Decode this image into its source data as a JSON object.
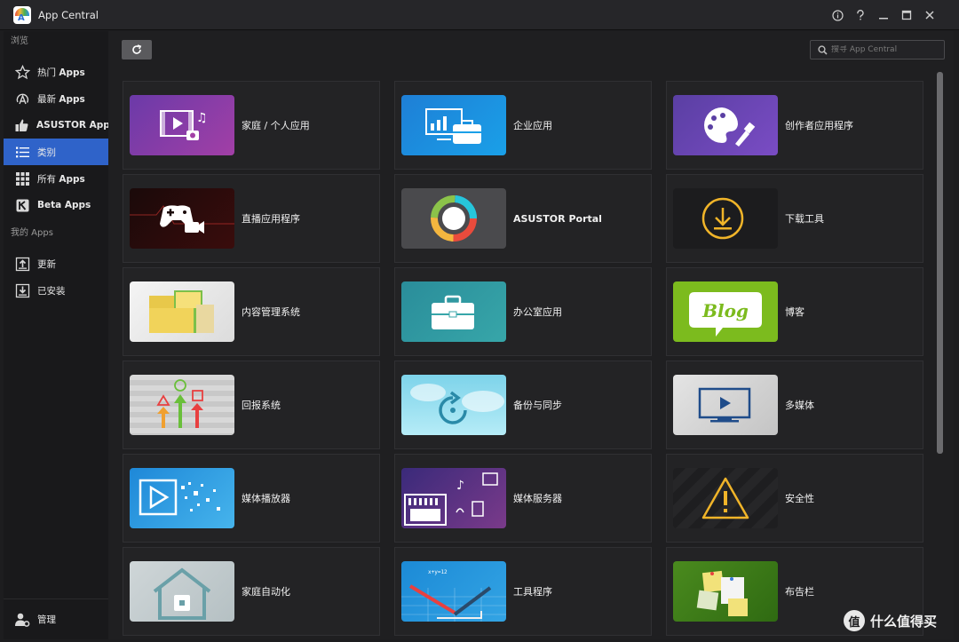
{
  "window": {
    "title": "App Central"
  },
  "sidebar": {
    "browse_label": "浏览",
    "browse_items": [
      {
        "label_cn": "热门 ",
        "label_en": "Apps",
        "icon": "star-icon"
      },
      {
        "label_cn": "最新 ",
        "label_en": "Apps",
        "icon": "new-icon"
      },
      {
        "label_cn": "",
        "label_en": "ASUSTOR Apps",
        "icon": "thumbs-up-icon"
      },
      {
        "label_cn": "类别",
        "label_en": "",
        "icon": "list-icon",
        "active": true
      },
      {
        "label_cn": "所有 ",
        "label_en": "Apps",
        "icon": "grid-icon"
      },
      {
        "label_cn": "",
        "label_en": "Beta Apps",
        "icon": "beta-icon"
      }
    ],
    "my_apps_label": "我的 Apps",
    "my_items": [
      {
        "label": "更新",
        "icon": "upload-icon"
      },
      {
        "label": "已安装",
        "icon": "download-icon"
      }
    ],
    "manage_label": "管理"
  },
  "toolbar": {
    "search_placeholder": "搜寻 App Central"
  },
  "categories": [
    {
      "label": "家庭 / 个人应用",
      "icon": "home-media-icon",
      "bold": false
    },
    {
      "label": "企业应用",
      "icon": "business-icon",
      "bold": false
    },
    {
      "label": "创作者应用程序",
      "icon": "palette-icon",
      "bold": false
    },
    {
      "label": "直播应用程序",
      "icon": "gamepad-icon",
      "bold": false
    },
    {
      "label": "ASUSTOR Portal",
      "icon": "portal-ring-icon",
      "bold": true
    },
    {
      "label": "下载工具",
      "icon": "download-circle-icon",
      "bold": false
    },
    {
      "label": "内容管理系统",
      "icon": "folders-icon",
      "bold": false
    },
    {
      "label": "办公室应用",
      "icon": "briefcase-icon",
      "bold": false
    },
    {
      "label": "博客",
      "icon": "blog-bubble-icon",
      "bold": false
    },
    {
      "label": "回报系统",
      "icon": "report-arrows-icon",
      "bold": false
    },
    {
      "label": "备份与同步",
      "icon": "sync-icon",
      "bold": false
    },
    {
      "label": "多媒体",
      "icon": "monitor-play-icon",
      "bold": false
    },
    {
      "label": "媒体播放器",
      "icon": "player-icon",
      "bold": false
    },
    {
      "label": "媒体服务器",
      "icon": "media-server-icon",
      "bold": false
    },
    {
      "label": "安全性",
      "icon": "warning-icon",
      "bold": false
    },
    {
      "label": "家庭自动化",
      "icon": "smart-home-icon",
      "bold": false
    },
    {
      "label": "工具程序",
      "icon": "tools-icon",
      "bold": false
    },
    {
      "label": "布告栏",
      "icon": "notes-board-icon",
      "bold": false
    }
  ],
  "watermark": {
    "symbol": "值",
    "text": "什么值得买"
  }
}
